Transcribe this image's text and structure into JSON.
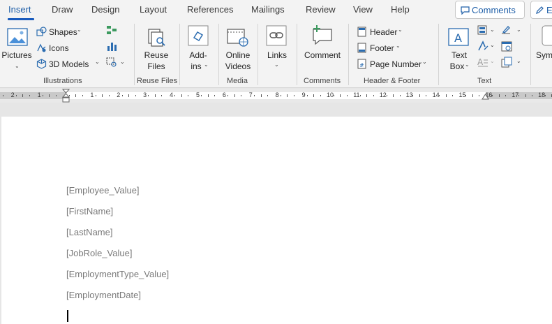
{
  "tabs": [
    {
      "label": "Insert",
      "active": true
    },
    {
      "label": "Draw"
    },
    {
      "label": "Design"
    },
    {
      "label": "Layout"
    },
    {
      "label": "References"
    },
    {
      "label": "Mailings"
    },
    {
      "label": "Review"
    },
    {
      "label": "View"
    },
    {
      "label": "Help"
    }
  ],
  "comments_button": "Comments",
  "editing_button": "Editing",
  "ribbon": {
    "pictures": "Pictures",
    "shapes": "Shapes",
    "icons": "Icons",
    "models3d": "3D Models",
    "illustrations_label": "Illustrations",
    "reuse_l1": "Reuse",
    "reuse_l2": "Files",
    "reuse_files_label": "Reuse Files",
    "addins_l1": "Add-",
    "addins_l2": "ins",
    "online_l1": "Online",
    "online_l2": "Videos",
    "media_label": "Media",
    "links": "Links",
    "comment": "Comment",
    "comments_label": "Comments",
    "header": "Header",
    "footer": "Footer",
    "page_number": "Page Number",
    "header_footer_label": "Header & Footer",
    "textbox_l1": "Text",
    "textbox_l2": "Box",
    "text_label": "Text",
    "symbols": "Symbols"
  },
  "ruler": {
    "numbers": [
      "2",
      "1",
      "1",
      "2",
      "3",
      "4",
      "5",
      "6",
      "7",
      "8",
      "9",
      "10",
      "11",
      "12",
      "13",
      "14",
      "15",
      "16",
      "17",
      "18"
    ]
  },
  "document": {
    "fields": [
      "[Employee_Value]",
      "[FirstName]",
      "[LastName]",
      "[JobRole_Value]",
      "[EmploymentType_Value]",
      "[EmploymentDate]"
    ]
  },
  "colors": {
    "accent": "#185abd",
    "field_text": "#7a7a7a",
    "ribbon_bg": "#f3f3f3"
  }
}
